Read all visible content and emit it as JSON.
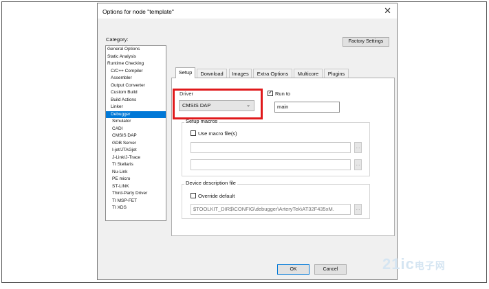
{
  "dialog": {
    "title": "Options for node \"template\"",
    "close_glyph": "✕"
  },
  "category": {
    "label": "Category:",
    "items": [
      {
        "label": "General Options",
        "level": 0
      },
      {
        "label": "Static Analysis",
        "level": 0
      },
      {
        "label": "Runtime Checking",
        "level": 0
      },
      {
        "label": "C/C++ Compiler",
        "level": 1
      },
      {
        "label": "Assembler",
        "level": 1
      },
      {
        "label": "Output Converter",
        "level": 1
      },
      {
        "label": "Custom Build",
        "level": 1
      },
      {
        "label": "Build Actions",
        "level": 1
      },
      {
        "label": "Linker",
        "level": 1
      },
      {
        "label": "Debugger",
        "level": 1,
        "selected": true
      },
      {
        "label": "Simulator",
        "level": 2
      },
      {
        "label": "CADI",
        "level": 2
      },
      {
        "label": "CMSIS DAP",
        "level": 2
      },
      {
        "label": "GDB Server",
        "level": 2
      },
      {
        "label": "I-jet/JTAGjet",
        "level": 2
      },
      {
        "label": "J-Link/J-Trace",
        "level": 2
      },
      {
        "label": "TI Stellaris",
        "level": 2
      },
      {
        "label": "Nu-Link",
        "level": 2
      },
      {
        "label": "PE micro",
        "level": 2
      },
      {
        "label": "ST-LINK",
        "level": 2
      },
      {
        "label": "Third-Party Driver",
        "level": 2
      },
      {
        "label": "TI MSP-FET",
        "level": 2
      },
      {
        "label": "TI XDS",
        "level": 2
      }
    ]
  },
  "factory_button": "Factory Settings",
  "tabs": [
    "Setup",
    "Download",
    "Images",
    "Extra Options",
    "Multicore",
    "Plugins"
  ],
  "setup": {
    "driver_label": "Driver",
    "driver_value": "CMSIS DAP",
    "run_to_label": "Run to",
    "run_to_checked": true,
    "run_to_value": "main",
    "macros_group": "Setup macros",
    "use_macro_label": "Use macro file(s)",
    "ellipsis": "...",
    "device_group": "Device description file",
    "override_label": "Override default",
    "device_path": "$TOOLKIT_DIR$\\CONFIG\\debugger\\ArteryTek\\AT32F435xM."
  },
  "footer": {
    "ok": "OK",
    "cancel": "Cancel"
  },
  "watermark": {
    "brand": "21ic",
    "cn": "电子网"
  },
  "colors": {
    "selection": "#0078d7",
    "highlight": "#e0191b"
  }
}
